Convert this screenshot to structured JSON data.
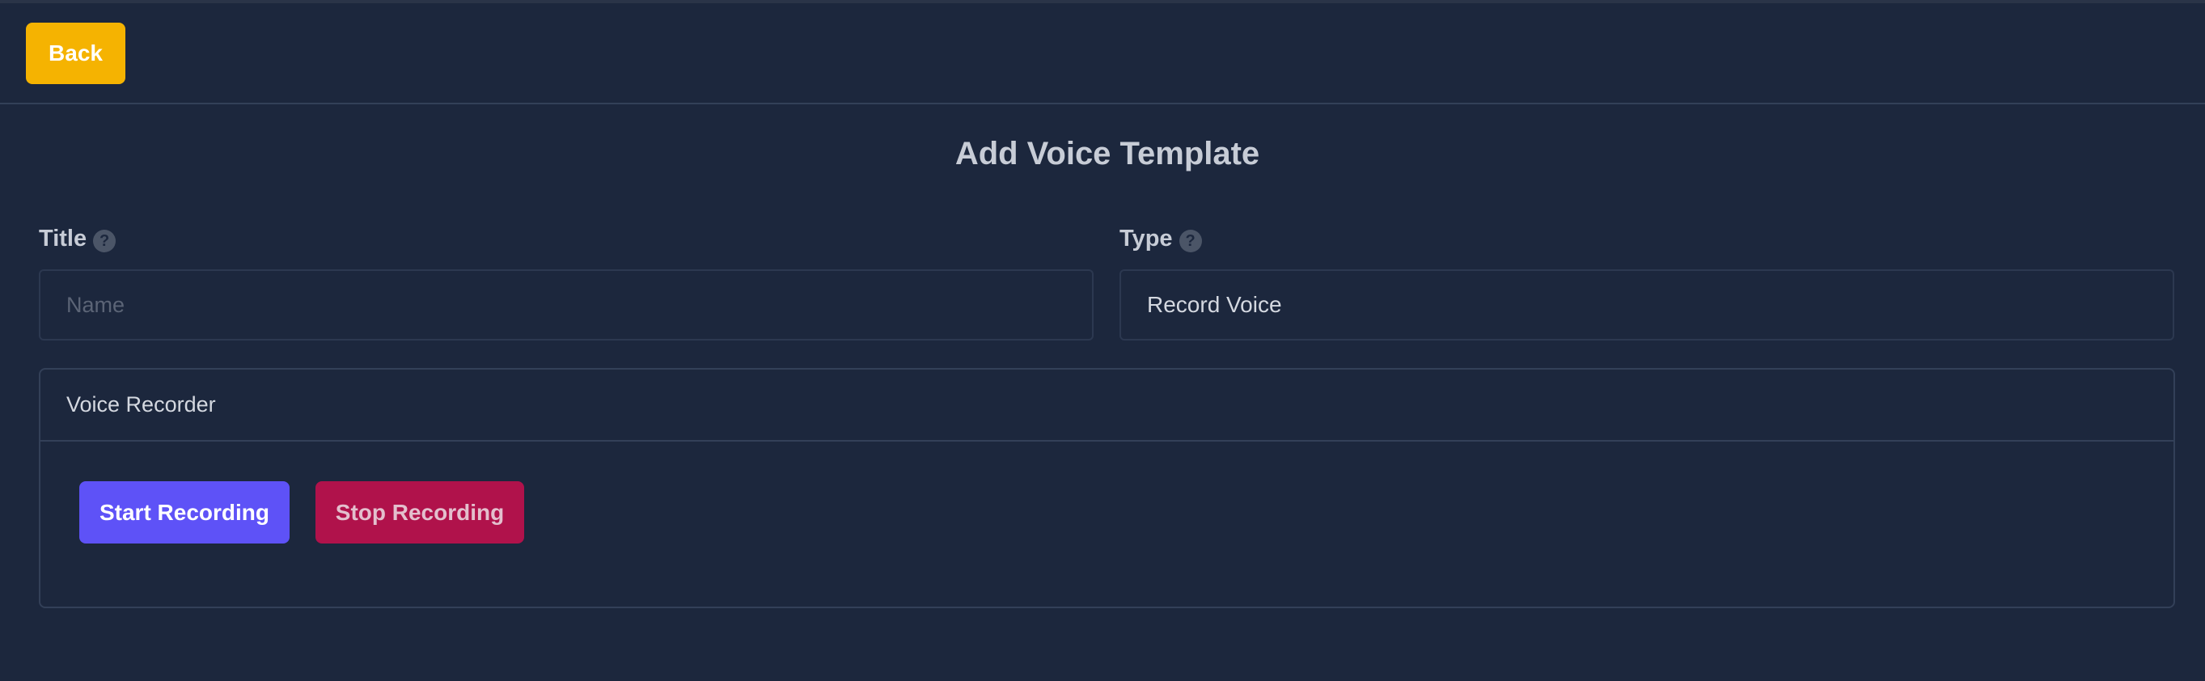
{
  "header": {
    "back_label": "Back"
  },
  "page": {
    "title": "Add Voice Template"
  },
  "form": {
    "title_label": "Title",
    "title_placeholder": "Name",
    "title_value": "",
    "type_label": "Type",
    "type_value": "Record Voice",
    "help_glyph": "?"
  },
  "recorder": {
    "heading": "Voice Recorder",
    "start_label": "Start Recording",
    "stop_label": "Stop Recording"
  },
  "colors": {
    "background": "#1c273d",
    "back_button": "#f5b301",
    "start_button": "#5e52f7",
    "stop_button": "#b0124b"
  },
  "icons": {
    "help": "question-circle-icon"
  }
}
